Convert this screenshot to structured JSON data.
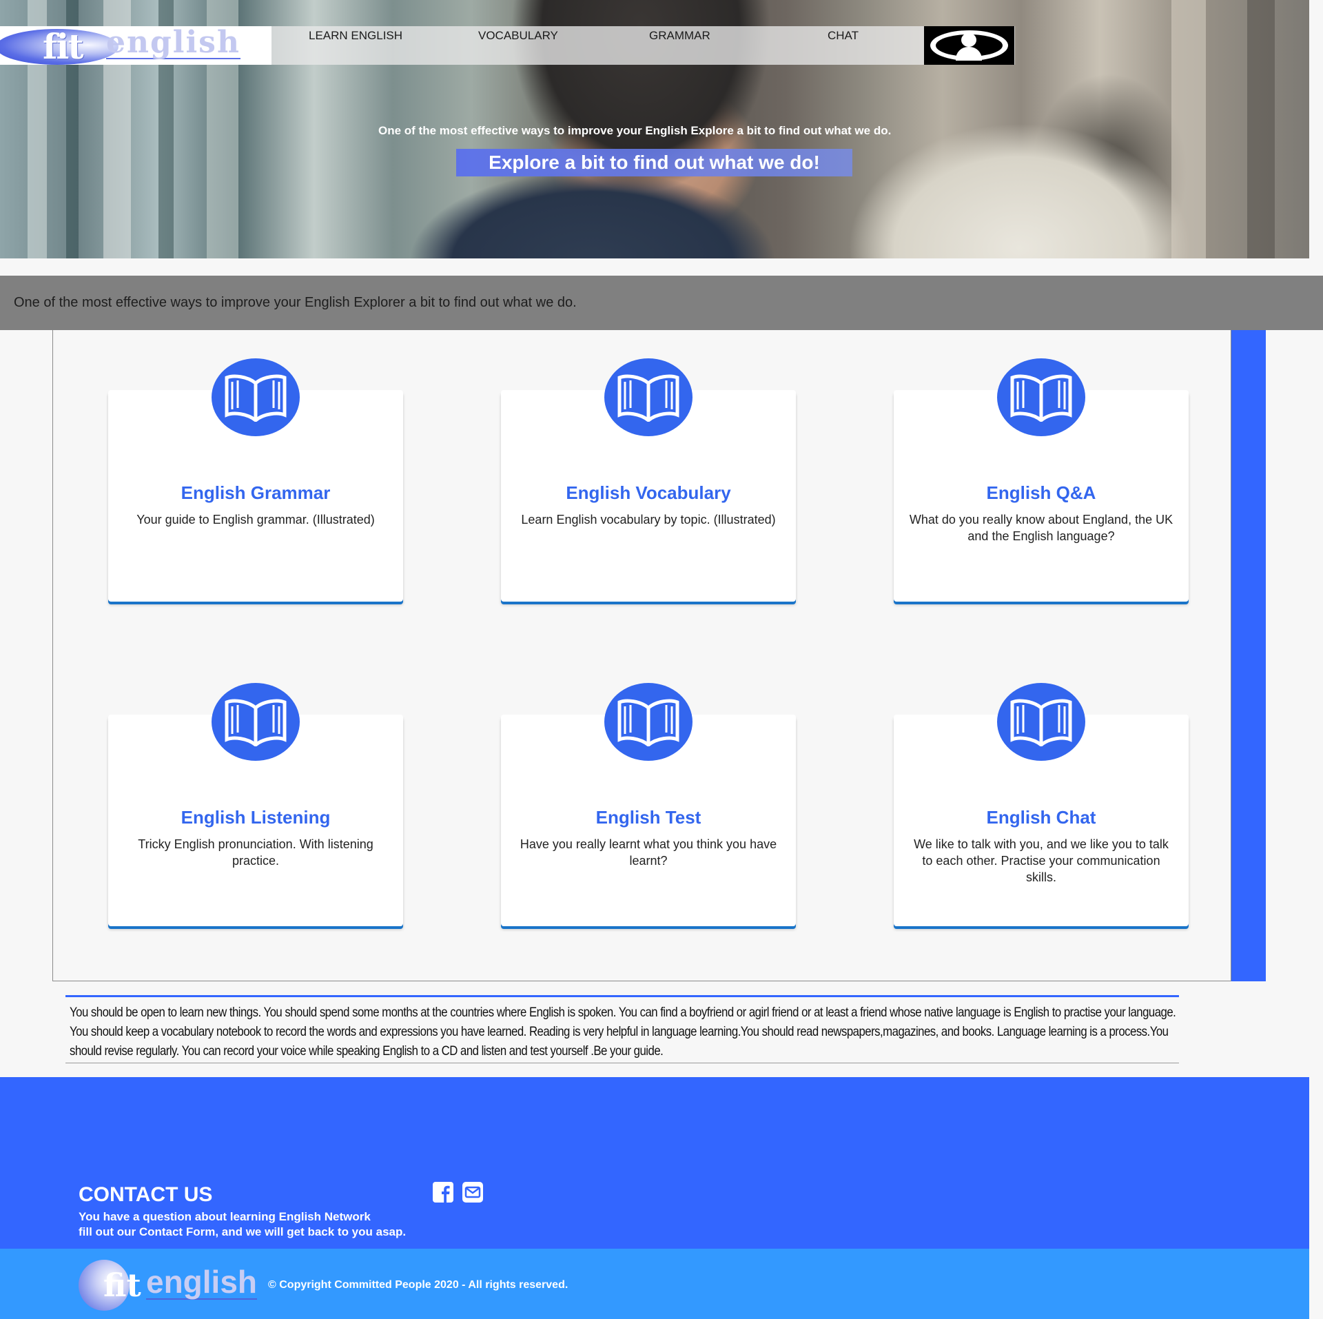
{
  "brand": {
    "logo_fit": "fit",
    "logo_english": "english"
  },
  "nav": {
    "items": [
      {
        "label": "LEARN ENGLISH"
      },
      {
        "label": "VOCABULARY"
      },
      {
        "label": "GRAMMAR"
      },
      {
        "label": "CHAT"
      }
    ],
    "user_icon": "user-profile-icon"
  },
  "hero": {
    "subtitle": "One of the most effective ways to improve your English Explore a bit to find out what we do.",
    "banner": "Explore a bit to find out what we do!"
  },
  "intro": {
    "text": "One of the most effective ways to improve your English Explorer a bit to find out what we do."
  },
  "features": {
    "icon": "open-book-icon",
    "cards": [
      {
        "title": "English Grammar",
        "desc": "Your guide to English grammar. (Illustrated)"
      },
      {
        "title": "English Vocabulary",
        "desc": "Learn English vocabulary by topic. (Illustrated)"
      },
      {
        "title": "English Q&A",
        "desc": "What do you really know about England, the UK and the English language?"
      },
      {
        "title": "English Listening",
        "desc": "Tricky English pronunciation. With listening practice."
      },
      {
        "title": "English Test",
        "desc": "Have you really learnt what you think you have learnt?"
      },
      {
        "title": "English Chat",
        "desc": "We like to talk with you, and we like you to talk to each other. Practise your communication skills."
      }
    ]
  },
  "tips": {
    "text": "You should be open to learn new things. You should spend some months at the countries where English is spoken. You can find a boyfriend or agirl friend or at least a friend whose native language is English to practise your language. You should keep a vocabulary notebook to record the words and expressions you have learned. Reading is very helpful in language learning.You should read newspapers,magazines, and books. Language learning is a process.You should revise regularly. You can record your voice while speaking English to a CD and listen and test yourself .Be your guide."
  },
  "footer": {
    "contact_title": "CONTACT US",
    "contact_line1": "You have a question about learning English Network",
    "contact_line2": "fill out our Contact Form, and we will get back to you asap.",
    "social_icons": [
      "facebook-icon",
      "mail-icon"
    ],
    "logo_fit": "fit",
    "logo_english": "english",
    "copyright": "© Copyright Committed People 2020 - All rights reserved."
  },
  "colors": {
    "accent_blue": "#3366ff",
    "card_title_blue": "#3366ee",
    "footer_light_blue": "#3399ff",
    "gray_strip": "#808080"
  }
}
